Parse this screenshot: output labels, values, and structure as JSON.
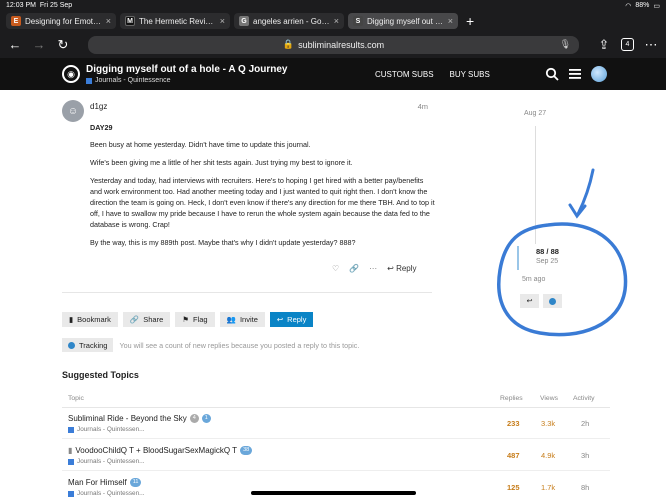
{
  "status": {
    "time": "12:03 PM",
    "date": "Fri 25 Sep",
    "battery": "88%"
  },
  "browser_tabs": [
    {
      "favicon": "E",
      "favicon_color": "#c95b1e",
      "title": "Designing for Emotional",
      "active": false
    },
    {
      "favicon": "M",
      "favicon_color": "#111111",
      "title": "The Hermetic Revival: 7",
      "active": false
    },
    {
      "favicon": "G",
      "favicon_color": "#777777",
      "title": "angeles arrien - Google",
      "active": false
    },
    {
      "favicon": "S",
      "favicon_color": "#444444",
      "title": "Digging myself out of a h",
      "active": true
    }
  ],
  "toolbar": {
    "url": "subliminalresults.com",
    "tab_count": "4"
  },
  "site": {
    "title": "Digging myself out of a hole - A Q Journey",
    "category": "Journals - Quintessence",
    "nav": [
      "CUSTOM SUBS",
      "BUY SUBS"
    ]
  },
  "post": {
    "username": "d1gz",
    "time": "4m",
    "heading": "DAY29",
    "paragraphs": [
      "Been busy at home yesterday. Didn't have time to update this journal.",
      "Wife's been giving me a little of her shit tests again. Just trying my best to ignore it.",
      "Yesterday and today, had interviews with recruiters. Here's to hoping I get hired with a better pay/benefits and work environment too. Had another meeting today and I just wanted to quit right then. I don't know the direction the team is going on. Heck, I don't even know if there's any direction for me there TBH. And to top it off, I have to swallow my pride because I have to rerun the whole system again because the data fed to the database is wrong. Crap!",
      "By the way, this is my 889th post. Maybe that's why I didn't update yesterday? 888?"
    ],
    "reply_label": "Reply"
  },
  "actions": {
    "bookmark": "Bookmark",
    "share": "Share",
    "flag": "Flag",
    "invite": "Invite",
    "reply": "Reply"
  },
  "tracking": {
    "label": "Tracking",
    "text": "You will see a count of new replies because you posted a reply to this topic."
  },
  "timeline": {
    "top_date": "Aug 27",
    "position": "88 / 88",
    "date": "Sep 25",
    "ago": "5m ago"
  },
  "suggested": {
    "title": "Suggested Topics",
    "columns": [
      "Topic",
      "Replies",
      "Views",
      "Activity"
    ],
    "rows": [
      {
        "title": "Subliminal Ride - Beyond the Sky",
        "badges": [
          "4",
          "1"
        ],
        "category": "Journals - Quintessen...",
        "replies": "233",
        "views": "3.3k",
        "activity": "2h"
      },
      {
        "title": "VoodooChildQ T + BloodSugarSexMagickQ T",
        "badges": [
          "38"
        ],
        "category": "Journals - Quintessen...",
        "replies": "487",
        "views": "4.9k",
        "activity": "3h"
      },
      {
        "title": "Man For Himself",
        "badges": [
          "11"
        ],
        "category": "Journals - Quintessen...",
        "replies": "125",
        "views": "1.7k",
        "activity": "8h"
      }
    ]
  },
  "colors": {
    "accent": "#0a84c6",
    "annotation": "#3a7bd5",
    "header_bg": "#111111"
  }
}
